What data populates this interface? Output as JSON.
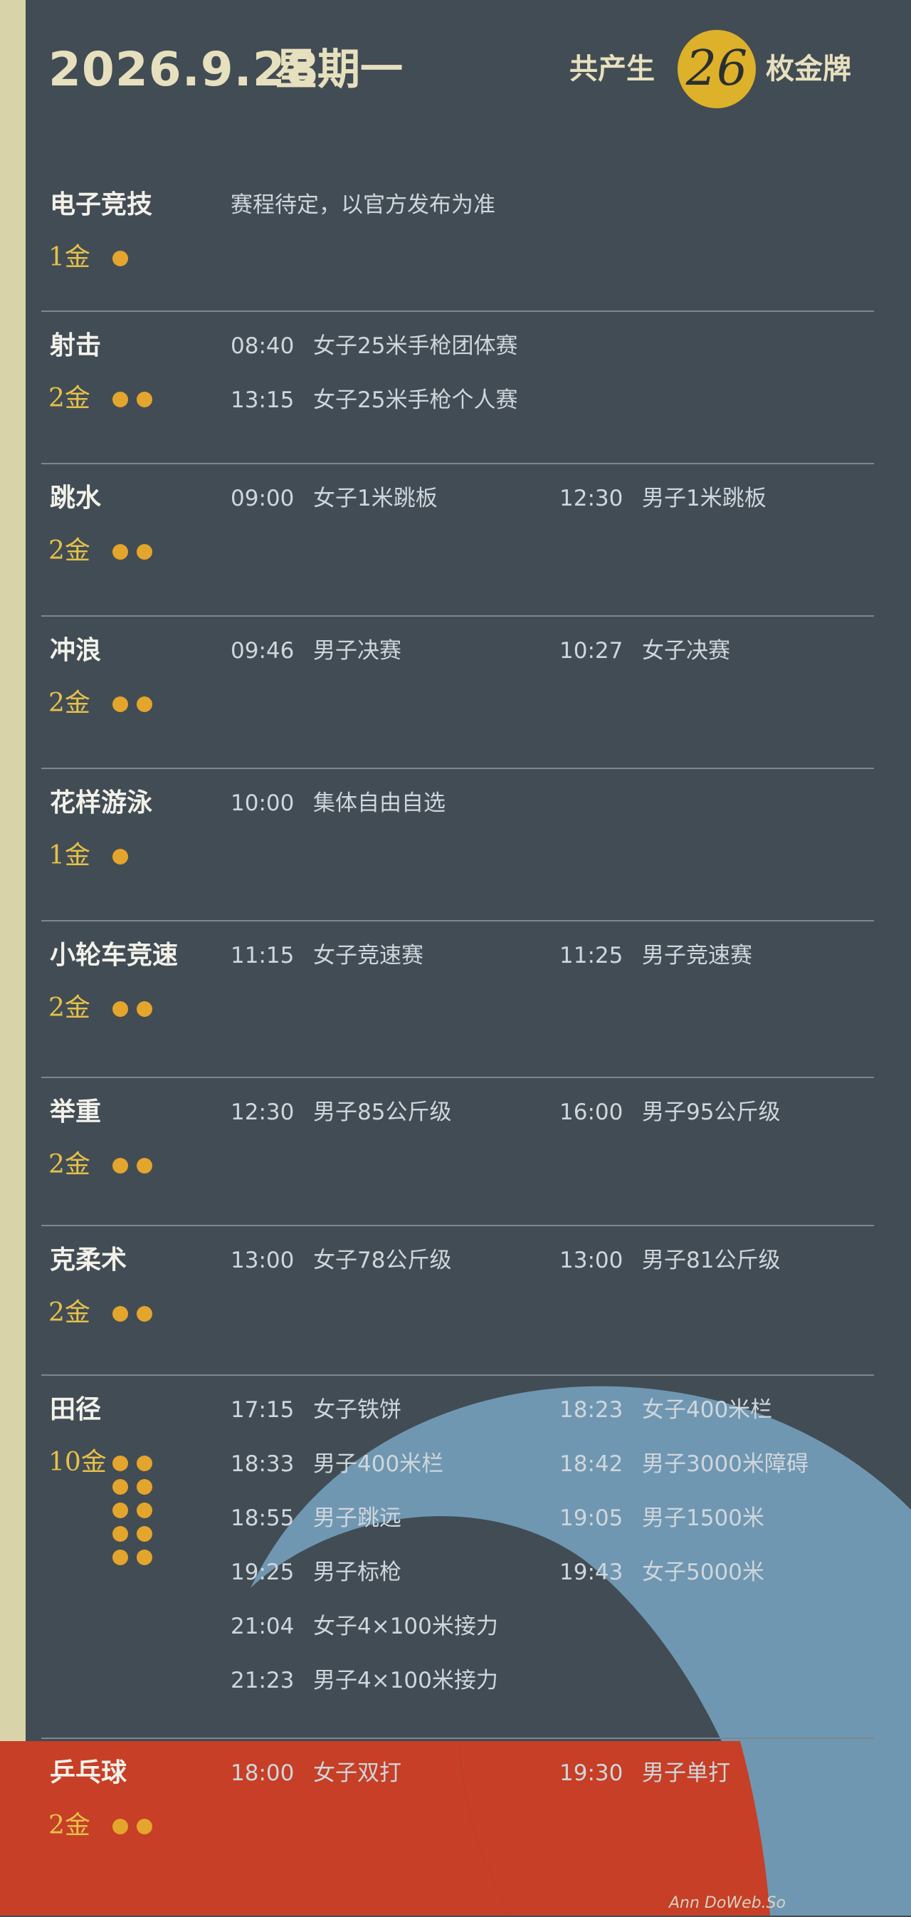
{
  "header": {
    "date": "2026.9.28",
    "weekday": "星期一",
    "medal_prefix": "共产生",
    "medal_count": "26",
    "medal_suffix": "枚金牌"
  },
  "colors": {
    "background": "#424c54",
    "accent_gold": "#ddb12a",
    "dot_gold": "#e4a52c",
    "stripe_cream": "#d9d3a9",
    "wave_blue": "#6f97b1",
    "wave_red": "#c63f26"
  },
  "sports": [
    {
      "name": "电子竞技",
      "gold": "1金",
      "dots": 1,
      "note": "赛程待定，以官方发布为准",
      "events": []
    },
    {
      "name": "射击",
      "gold": "2金",
      "dots": 2,
      "events": [
        {
          "time": "08:40",
          "title": "女子25米手枪团体赛"
        },
        {
          "time": "13:15",
          "title": "女子25米手枪个人赛"
        }
      ]
    },
    {
      "name": "跳水",
      "gold": "2金",
      "dots": 2,
      "events": [
        {
          "time": "09:00",
          "title": "女子1米跳板"
        },
        {
          "time": "12:30",
          "title": "男子1米跳板"
        }
      ]
    },
    {
      "name": "冲浪",
      "gold": "2金",
      "dots": 2,
      "events": [
        {
          "time": "09:46",
          "title": "男子决赛"
        },
        {
          "time": "10:27",
          "title": "女子决赛"
        }
      ]
    },
    {
      "name": "花样游泳",
      "gold": "1金",
      "dots": 1,
      "events": [
        {
          "time": "10:00",
          "title": "集体自由自选"
        }
      ]
    },
    {
      "name": "小轮车竞速",
      "gold": "2金",
      "dots": 2,
      "events": [
        {
          "time": "11:15",
          "title": "女子竞速赛"
        },
        {
          "time": "11:25",
          "title": "男子竞速赛"
        }
      ]
    },
    {
      "name": "举重",
      "gold": "2金",
      "dots": 2,
      "events": [
        {
          "time": "12:30",
          "title": "男子85公斤级"
        },
        {
          "time": "16:00",
          "title": "男子95公斤级"
        }
      ]
    },
    {
      "name": "克柔术",
      "gold": "2金",
      "dots": 2,
      "events": [
        {
          "time": "13:00",
          "title": "女子78公斤级"
        },
        {
          "time": "13:00",
          "title": "男子81公斤级"
        }
      ]
    },
    {
      "name": "田径",
      "gold": "10金",
      "dots": 10,
      "events": [
        {
          "time": "17:15",
          "title": "女子铁饼"
        },
        {
          "time": "18:23",
          "title": "女子400米栏"
        },
        {
          "time": "18:33",
          "title": "男子400米栏"
        },
        {
          "time": "18:42",
          "title": "男子3000米障碍"
        },
        {
          "time": "18:55",
          "title": "男子跳远"
        },
        {
          "time": "19:05",
          "title": "男子1500米"
        },
        {
          "time": "19:25",
          "title": "男子标枪"
        },
        {
          "time": "19:43",
          "title": "女子5000米"
        },
        {
          "time": "21:04",
          "title": "女子4×100米接力"
        },
        {
          "time": "21:23",
          "title": "男子4×100米接力"
        }
      ]
    },
    {
      "name": "乒乓球",
      "gold": "2金",
      "dots": 2,
      "events": [
        {
          "time": "18:00",
          "title": "女子双打"
        },
        {
          "time": "19:30",
          "title": "男子单打"
        }
      ]
    }
  ],
  "watermark": "Ann DoWeb.So"
}
